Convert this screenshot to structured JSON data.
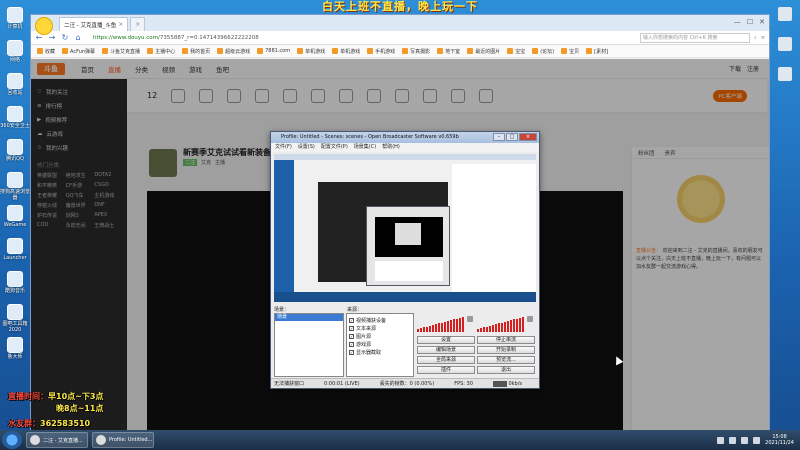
{
  "overlay": {
    "banner": "白天上班不直播，晚上玩一下",
    "schedule_label": "直播时间：",
    "schedule_morning": "早10点~下3点",
    "schedule_evening": "晚8点~11点",
    "qq_label": "水友群：",
    "qq_number": "362583510"
  },
  "desktop_icons": [
    {
      "label": "计算机"
    },
    {
      "label": "网络"
    },
    {
      "label": "回收站"
    },
    {
      "label": "360安全卫士"
    },
    {
      "label": "腾讯QQ"
    },
    {
      "label": "搜狗高速浏览器"
    },
    {
      "label": "WeGame"
    },
    {
      "label": "Launcher"
    },
    {
      "label": "酷狗音乐"
    },
    {
      "label": "图吧工具箱2020"
    },
    {
      "label": "鲁大师"
    }
  ],
  "browser": {
    "tabs": [
      {
        "label": "二汪 - 艾克直播_斗鱼",
        "close": "×"
      },
      {
        "label": "×"
      }
    ],
    "url_domain": "https://www.douyu.com/",
    "url_path": "7355887_r=0.14714396622222208",
    "search_placeholder": "输入你想搜索的内容 Ctrl+K 搜索",
    "bookmarks": [
      "收藏",
      "AcFun弹幕",
      "斗鱼艾克直播",
      "主播中心",
      "我的首页",
      "超级云游戏",
      "7881.com",
      "单机游戏",
      "单机游戏",
      "手机游戏",
      "写真摄影",
      "地下室",
      "最近的图片",
      "宝宝",
      "(论坛)",
      "宝贝",
      "[素材]"
    ]
  },
  "douyu": {
    "logo": "斗鱼",
    "nav": [
      "首页",
      "直播",
      "分类",
      "视频",
      "游戏",
      "鱼吧"
    ],
    "active_nav": "直播",
    "user_links": [
      "下载",
      "注册"
    ],
    "sidebar_items": [
      "我的关注",
      "排行榜",
      "视频推荐",
      "云游戏",
      "我的兴趣"
    ],
    "sidebar_section": "热门分类",
    "sidebar_grid": [
      "英雄联盟",
      "绝地求生",
      "DOTA2",
      "和平精英",
      "CF手游",
      "CSGO",
      "王者荣耀",
      "QQ飞车",
      "主机游戏",
      "穿越火线",
      "魔兽世界",
      "DNF",
      "炉石传说",
      "剑网3",
      "APEX",
      "COD",
      "永劫无间",
      "王牌战士"
    ],
    "toolbar_count": "12",
    "pc_button": "PC客户端",
    "room_title": "新赛季艾克试试看新装备",
    "room_tags": [
      "二汪",
      "艾克",
      "主播"
    ],
    "chat_tabs": [
      "粉丝团",
      "贵宾"
    ],
    "announce_label": "直播公告：",
    "announce_text": "欢迎来到二汪 - 艾克的直播间，喜欢的朋友可以点个关注，白天上班不直播，晚上玩一下，有问题可以加水友群一起交流游戏心得。"
  },
  "obs": {
    "title": "Profile: Untitled - Scenes: scenes - Open Broadcaster Software v0.659b",
    "menu": [
      "文件(F)",
      "设置(S)",
      "配置文件(P)",
      "场景集(C)",
      "帮助(H)"
    ],
    "scenes_label": "场景：",
    "sources_label": "来源：",
    "scenes": [
      "场景"
    ],
    "sources": [
      {
        "label": "视频捕获设备",
        "checked": true
      },
      {
        "label": "文本来源",
        "checked": true
      },
      {
        "label": "图片源",
        "checked": true
      },
      {
        "label": "游戏源",
        "checked": true
      },
      {
        "label": "显示器截取",
        "checked": true
      }
    ],
    "buttons": [
      "设置",
      "停止串流",
      "编辑场景",
      "开始录制",
      "全局来源",
      "预览流...",
      "插件",
      "退出"
    ],
    "status_left": "无法捕获窗口",
    "status_time": "0:00:01 (LIVE)",
    "status_dropped": "丢失的帧数：0 (0.00%)",
    "status_fps": "FPS: 30",
    "status_rate": "0kb/s"
  },
  "taskbar": {
    "items": [
      {
        "label": "二汪 - 艾克直播..."
      },
      {
        "label": "Profile: Untitled..."
      }
    ],
    "time": "15:08",
    "date": "2021/11/24"
  },
  "colors": {
    "accent": "#ff7a22",
    "overlay_yellow": "#ffe94a",
    "overlay_red": "#ff4a3a",
    "obs_live_red": "#d52020"
  }
}
